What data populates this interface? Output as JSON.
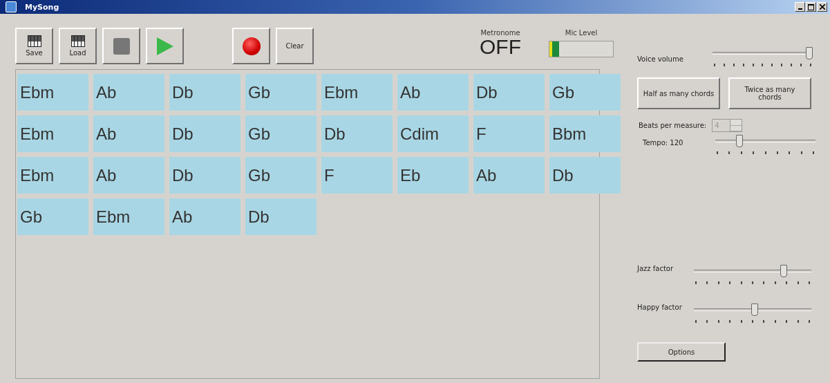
{
  "window": {
    "title": "MySong"
  },
  "toolbar": [
    {
      "kind": "piano",
      "label": "Save"
    },
    {
      "kind": "piano",
      "label": "Load"
    },
    {
      "kind": "stop"
    },
    {
      "kind": "play"
    },
    {
      "kind": "record"
    },
    {
      "kind": "text",
      "label": "Clear"
    }
  ],
  "metronome": {
    "label": "Metronome",
    "value": "OFF"
  },
  "mic_level": {
    "label": "Mic Level",
    "level": 0.15
  },
  "chords": [
    "Ebm",
    "Ab",
    "Db",
    "Gb",
    "Ebm",
    "Ab",
    "Db",
    "Gb",
    "Ebm",
    "Ab",
    "Db",
    "Gb",
    "Db",
    "Cdim",
    "F",
    "Bbm",
    "Ebm",
    "Ab",
    "Db",
    "Gb",
    "F",
    "Eb",
    "Ab",
    "Db",
    "Gb",
    "Ebm",
    "Ab",
    "Db"
  ],
  "voice_volume": {
    "label": "Voice volume",
    "level": 1.0
  },
  "chord_buttons": [
    "Half as many chords",
    "Twice as many chords"
  ],
  "beats_per_measure": {
    "label": "Beats per measure:",
    "value": "4",
    "disabled": true
  },
  "tempo": {
    "label": "Tempo: 120",
    "level": 0.22
  },
  "jazz_factor": {
    "label": "Jazz factor",
    "level": 0.78
  },
  "happy_factor": {
    "label": "Happy factor",
    "level": 0.52
  },
  "options_button": "Options"
}
